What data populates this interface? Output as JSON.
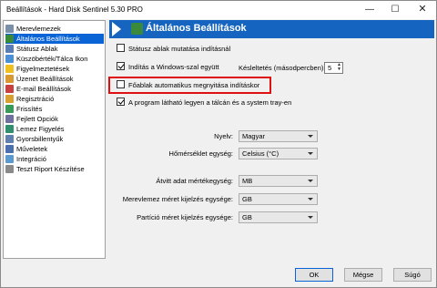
{
  "window": {
    "title": "Beállítások  -  Hard Disk Sentinel 5.30 PRO",
    "minimize": "—",
    "maximize": "☐",
    "close": "✕"
  },
  "sidebar": {
    "items": [
      {
        "label": "Merevlemezek",
        "icon_color": "#7a8fa8"
      },
      {
        "label": "Általános Beállítások",
        "icon_color": "#3b8a3b",
        "selected": true
      },
      {
        "label": "Státusz Ablak",
        "icon_color": "#5b7db5"
      },
      {
        "label": "Küszöbérték/Tálca Ikon",
        "icon_color": "#4a90d9"
      },
      {
        "label": "Figyelmeztetések",
        "icon_color": "#f0c020"
      },
      {
        "label": "Üzenet Beállítások",
        "icon_color": "#d89a30"
      },
      {
        "label": "E-mail Beállítások",
        "icon_color": "#c94040"
      },
      {
        "label": "Regisztráció",
        "icon_color": "#d8a030"
      },
      {
        "label": "Frissítés",
        "icon_color": "#3a9a5a"
      },
      {
        "label": "Fejlett Opciók",
        "icon_color": "#7070a0"
      },
      {
        "label": "Lemez Figyelés",
        "icon_color": "#2f8f6f"
      },
      {
        "label": "Gyorsbillentyűk",
        "icon_color": "#6080b0"
      },
      {
        "label": "Műveletek",
        "icon_color": "#4a70b0"
      },
      {
        "label": "Integráció",
        "icon_color": "#5a9ad0"
      },
      {
        "label": "Teszt Riport Készítése",
        "icon_color": "#8a8a8a"
      }
    ]
  },
  "panel": {
    "title": "Általános Beállítások"
  },
  "options": {
    "status_window_on_start": {
      "label": "Státusz ablak mutatása indításnál",
      "checked": false
    },
    "start_with_windows": {
      "label": "Indítás a Windows-szal együtt",
      "checked": true
    },
    "delay_label": "Késleltetés (másodpercben):",
    "delay_value": "5",
    "open_main_window": {
      "label": "Főablak automatikus megnyitása indításkor",
      "checked": false
    },
    "tray_visible": {
      "label": "A program látható legyen a tálcán és a system tray-en",
      "checked": true
    }
  },
  "selects": {
    "language": {
      "label": "Nyelv:",
      "value": "Magyar"
    },
    "temperature": {
      "label": "Hőmérséklet egység:",
      "value": "Celsius (°C)"
    },
    "transfer_unit": {
      "label": "Átvitt adat mértékegység:",
      "value": "MB"
    },
    "disk_size_unit": {
      "label": "Merevlemez méret kijelzés egysége:",
      "value": "GB"
    },
    "partition_size_unit": {
      "label": "Partíció méret kijelzés egysége:",
      "value": "GB"
    }
  },
  "buttons": {
    "ok": "OK",
    "cancel": "Mégse",
    "help": "Súgó"
  },
  "colors": {
    "header_bg": "#1565c0",
    "selection": "#0a64d6",
    "highlight_border": "#e01010"
  }
}
